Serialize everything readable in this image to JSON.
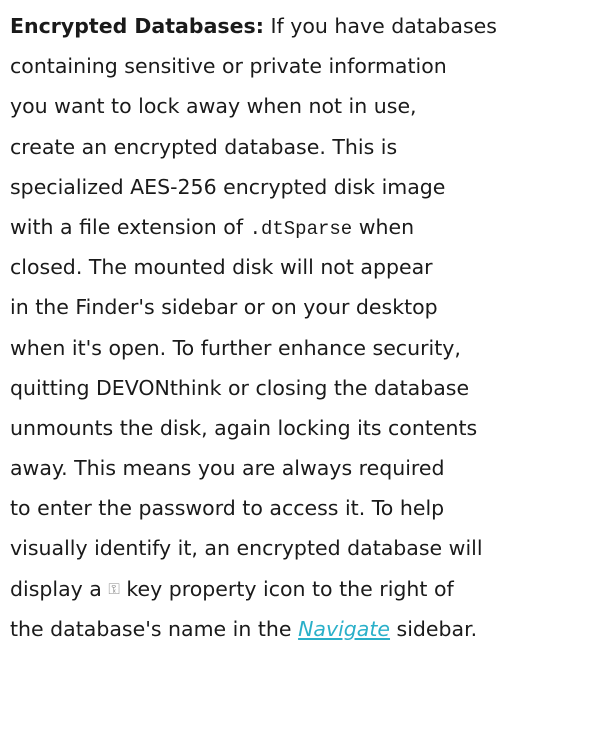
{
  "paragraph": {
    "heading": "Encrypted Databases:",
    "l1_rest": " If you have databases",
    "l2": "containing sensitive or private information",
    "l3": "you want to lock away when not in use,",
    "l4": "create an encrypted database. This is",
    "l5": "specialized AES-256 encrypted disk image",
    "l6_pre": "with a file extension of ",
    "l6_code": ".dtSparse",
    "l6_post": " when",
    "l7": "closed. The mounted disk will not appear",
    "l8": "in the Finder's sidebar or on your desktop",
    "l9": "when it's open. To further enhance security,",
    "l10": "quitting DEVONthink or closing the database",
    "l11": "unmounts the disk, again locking its contents",
    "l12": "away. This means you are always required",
    "l13": "to enter the password to access it. To help",
    "l14": "visually identify it, an encrypted database will",
    "l15_pre": "display a ",
    "l15_icon": "⚿",
    "l15_post": " key property icon to the right of",
    "l16_pre": "the database's name in the ",
    "l16_link": "Navigate",
    "l16_post": " sidebar."
  },
  "colors": {
    "text": "#1a1a1a",
    "link": "#2ab0c9",
    "icon": "#8a8a8a"
  },
  "icons": {
    "key": "key-icon"
  }
}
